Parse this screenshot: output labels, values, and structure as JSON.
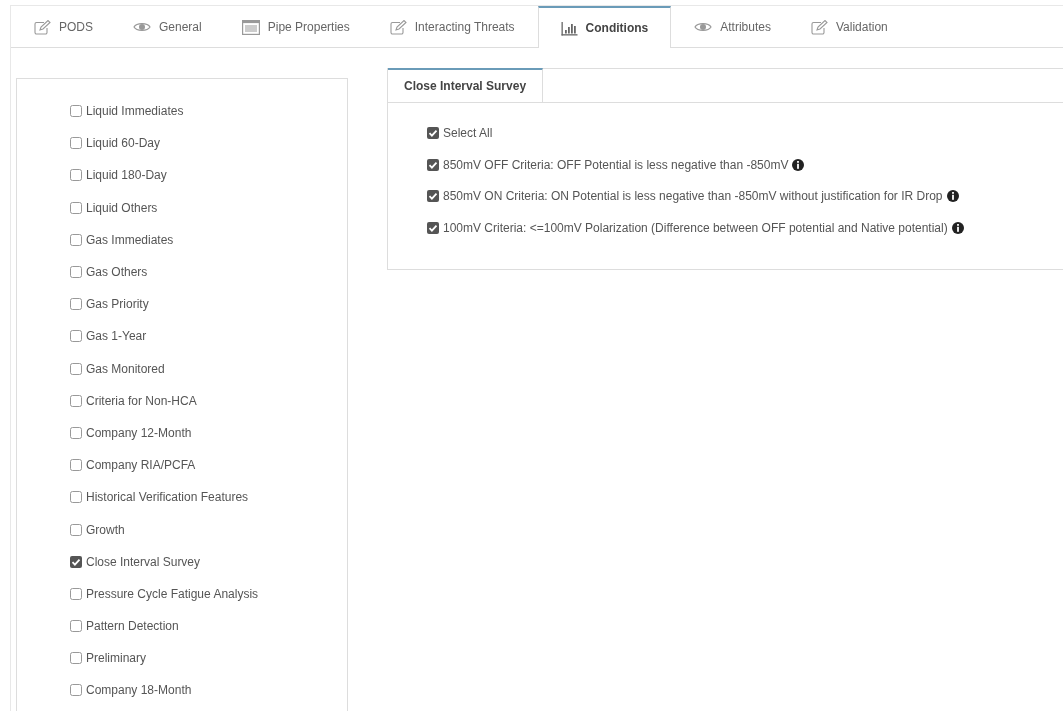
{
  "tabs": [
    {
      "label": "PODS",
      "kind": "edit",
      "selected": false
    },
    {
      "label": "General",
      "kind": "view",
      "selected": false
    },
    {
      "label": "Pipe Properties",
      "kind": "table",
      "selected": false
    },
    {
      "label": "Interacting Threats",
      "kind": "edit",
      "selected": false
    },
    {
      "label": "Conditions",
      "kind": "chart",
      "selected": true
    },
    {
      "label": "Attributes",
      "kind": "view",
      "selected": false
    },
    {
      "label": "Validation",
      "kind": "edit",
      "selected": false
    }
  ],
  "conditions": [
    {
      "label": "Liquid Immediates",
      "checked": false
    },
    {
      "label": "Liquid 60-Day",
      "checked": false
    },
    {
      "label": "Liquid 180-Day",
      "checked": false
    },
    {
      "label": "Liquid Others",
      "checked": false
    },
    {
      "label": "Gas Immediates",
      "checked": false
    },
    {
      "label": "Gas Others",
      "checked": false
    },
    {
      "label": "Gas Priority",
      "checked": false
    },
    {
      "label": "Gas 1-Year",
      "checked": false
    },
    {
      "label": "Gas Monitored",
      "checked": false
    },
    {
      "label": "Criteria for Non-HCA",
      "checked": false
    },
    {
      "label": "Company 12-Month",
      "checked": false
    },
    {
      "label": "Company RIA/PCFA",
      "checked": false
    },
    {
      "label": "Historical Verification Features",
      "checked": false
    },
    {
      "label": "Growth",
      "checked": false
    },
    {
      "label": "Close Interval Survey",
      "checked": true
    },
    {
      "label": "Pressure Cycle Fatigue Analysis",
      "checked": false
    },
    {
      "label": "Pattern Detection",
      "checked": false
    },
    {
      "label": "Preliminary",
      "checked": false
    },
    {
      "label": "Company 18-Month",
      "checked": false
    }
  ],
  "survey": {
    "tab": {
      "label": "Close Interval Survey",
      "selected": true
    },
    "options": [
      {
        "label": "Select All",
        "checked": true,
        "info": false
      },
      {
        "label": "850mV OFF Criteria: OFF Potential is less negative than -850mV",
        "checked": true,
        "info": true
      },
      {
        "label": "850mV ON Criteria: ON Potential is less negative than -850mV without justification for IR Drop",
        "checked": true,
        "info": true
      },
      {
        "label": "100mV Criteria: <=100mV Polarization (Difference between OFF potential and Native potential)",
        "checked": true,
        "info": true
      }
    ]
  }
}
